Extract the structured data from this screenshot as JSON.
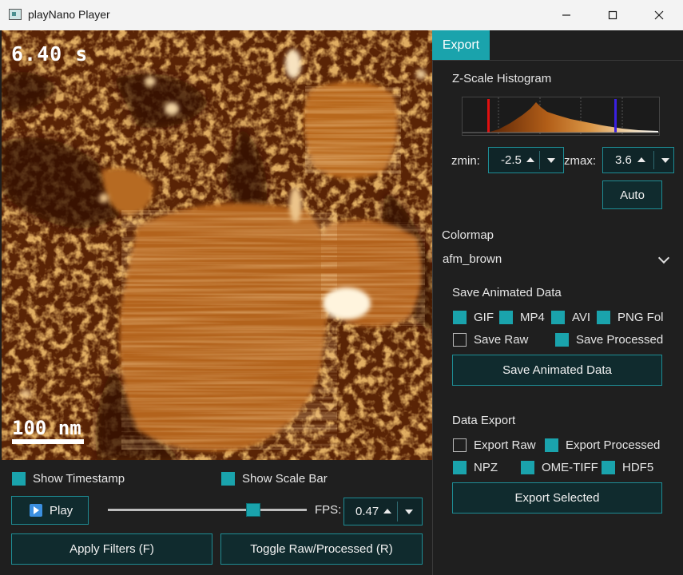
{
  "window": {
    "title": "playNano Player"
  },
  "viewer": {
    "timestamp": "6.40 s",
    "scale_bar_label": "100 nm",
    "colormap_colors": [
      "#3b1503",
      "#7a3309",
      "#b0601a",
      "#d99545",
      "#fff6e6"
    ]
  },
  "controls": {
    "show_timestamp": {
      "label": "Show Timestamp",
      "checked": true
    },
    "show_scale_bar": {
      "label": "Show Scale Bar",
      "checked": true
    },
    "play_label": "Play",
    "fps_label": "FPS:",
    "fps_value": "0.47",
    "playback_position": 0.73,
    "apply_filters_label": "Apply Filters (F)",
    "toggle_label": "Toggle Raw/Processed (R)"
  },
  "export_panel": {
    "tab_label": "Export",
    "histogram_title": "Z-Scale Histogram",
    "zmin_label": "zmin:",
    "zmin_value": "-2.5",
    "zmax_label": "zmax:",
    "zmax_value": "3.6",
    "auto_label": "Auto",
    "colormap_label": "Colormap",
    "colormap_value": "afm_brown",
    "save_section_label": "Save Animated Data",
    "formats": [
      {
        "label": "GIF",
        "checked": true
      },
      {
        "label": "MP4",
        "checked": true
      },
      {
        "label": "AVI",
        "checked": true
      },
      {
        "label": "PNG Folder",
        "checked": true
      }
    ],
    "save_raw": {
      "label": "Save Raw",
      "checked": false
    },
    "save_processed": {
      "label": "Save Processed",
      "checked": true
    },
    "save_button_label": "Save Animated Data",
    "data_export_label": "Data Export",
    "export_raw": {
      "label": "Export Raw",
      "checked": false
    },
    "export_processed": {
      "label": "Export Processed",
      "checked": true
    },
    "data_formats": [
      {
        "label": "NPZ",
        "checked": true
      },
      {
        "label": "OME-TIFF",
        "checked": true
      },
      {
        "label": "HDF5",
        "checked": true
      }
    ],
    "export_selected_label": "Export Selected"
  },
  "colors": {
    "accent": "#1aa3ac",
    "button_bg": "#102b2e",
    "background": "#1f1f1f",
    "zmin_marker": "#e01010",
    "zmax_marker": "#3a20e0"
  }
}
